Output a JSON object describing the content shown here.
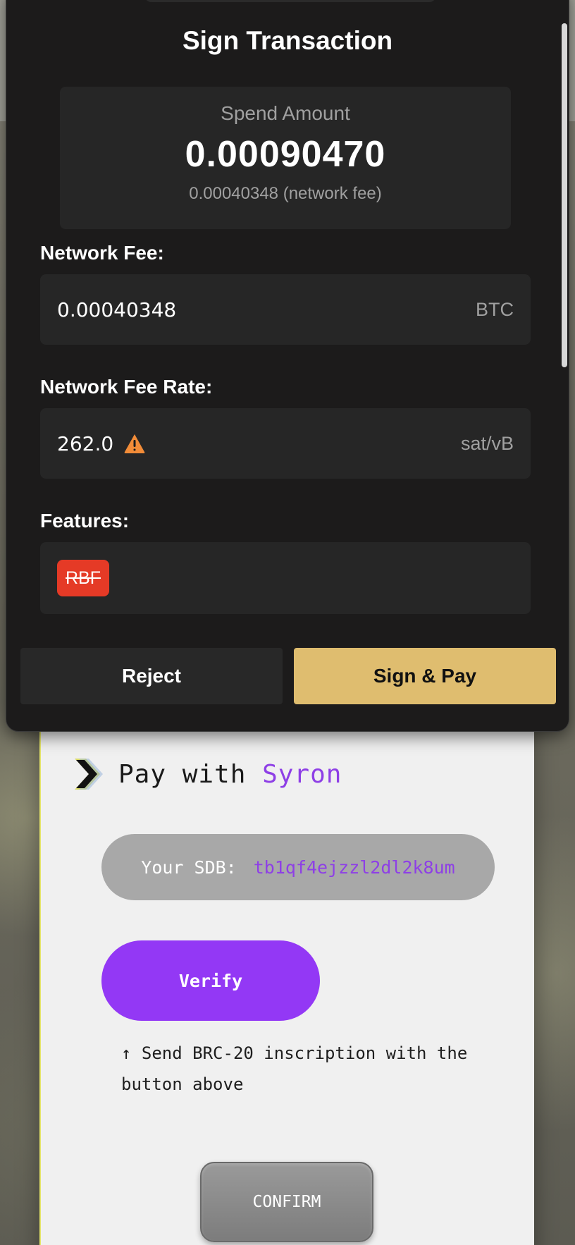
{
  "modal": {
    "title": "Sign Transaction",
    "spend_amount_label": "Spend Amount",
    "spend_amount_value": "0.00090470",
    "spend_amount_fee": "0.00040348 (network fee)",
    "network_fee": {
      "label": "Network Fee:",
      "value": "0.00040348",
      "unit": "BTC"
    },
    "network_fee_rate": {
      "label": "Network Fee Rate:",
      "value": "262.0",
      "unit": "sat/vB",
      "warning_icon": "warning-triangle-icon"
    },
    "features": {
      "label": "Features:",
      "badges": [
        "RBF"
      ]
    },
    "reject_label": "Reject",
    "sign_label": "Sign & Pay",
    "colors": {
      "background": "#1c1b1b",
      "panel": "#262626",
      "accent": "#dfbd6f",
      "warning": "#f28c38",
      "rbf": "#e53a26"
    }
  },
  "page": {
    "header_prefix": "Pay with",
    "header_brand": "Syron",
    "sdb_label": "Your SDB:",
    "sdb_value": "tb1qf4ejzzl2dl2k8um",
    "verify_label": "Verify",
    "hint": "↑ Send BRC-20 inscription with the button above",
    "confirm_label": "CONFIRM",
    "colors": {
      "brand": "#8e3fe6",
      "verify": "#9338f5"
    }
  }
}
